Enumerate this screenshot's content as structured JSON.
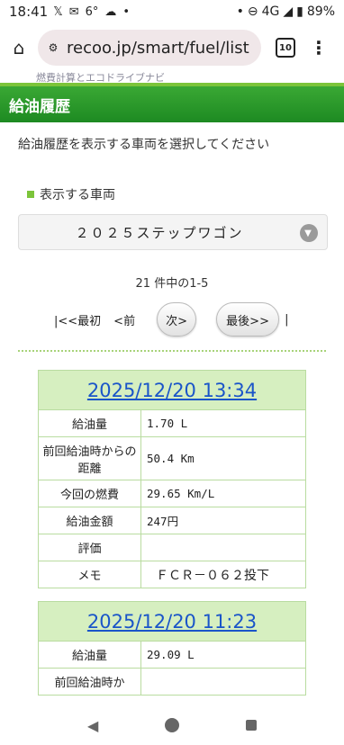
{
  "status_bar": {
    "time": "18:41",
    "temp": "6°",
    "network": "4G",
    "battery": "89%"
  },
  "browser": {
    "url": "recoo.jp/smart/fuel/list",
    "tab_count": "10"
  },
  "page": {
    "top_strip_text": "燃費計算とエコドライブナビ",
    "section_title": "給油履歴",
    "instruction": "給油履歴を表示する車両を選択してください",
    "vehicle_label": "表示する車両",
    "vehicle_selected": "２０２５ステップワゴン",
    "count_text": "21 件中の1-5",
    "pager": {
      "first": "|<<最初",
      "prev": "<前",
      "next": "次>",
      "last": "最後>>",
      "end_sep": "|"
    }
  },
  "records": [
    {
      "datetime": "2025/12/20 13:34",
      "rows": [
        {
          "label": "給油量",
          "value": "1.70 L"
        },
        {
          "label": "前回給油時からの距離",
          "value": "50.4 Km"
        },
        {
          "label": "今回の燃費",
          "value": "29.65 Km/L"
        },
        {
          "label": "給油金額",
          "value": "247円"
        },
        {
          "label": "評価",
          "value": ""
        },
        {
          "label": "メモ",
          "value": "ＦＣＲ－０６２投下"
        }
      ]
    },
    {
      "datetime": "2025/12/20 11:23",
      "rows": [
        {
          "label": "給油量",
          "value": "29.09 L"
        },
        {
          "label": "前回給油時か",
          "value": ""
        }
      ]
    }
  ],
  "icons": {
    "status": [
      "x-icon",
      "mail-icon",
      "weather-icon",
      "dnd-icon",
      "signal-icon",
      "battery-icon"
    ],
    "browser": [
      "home-icon",
      "site-info-icon",
      "menu-icon"
    ],
    "nav": [
      "back-icon",
      "home-nav-icon",
      "recents-icon"
    ]
  },
  "colors": {
    "header_green": "#2e9a2c",
    "accent_green": "#7cc43a",
    "table_header_bg": "#d6efc0",
    "link_blue": "#1a55c9"
  }
}
